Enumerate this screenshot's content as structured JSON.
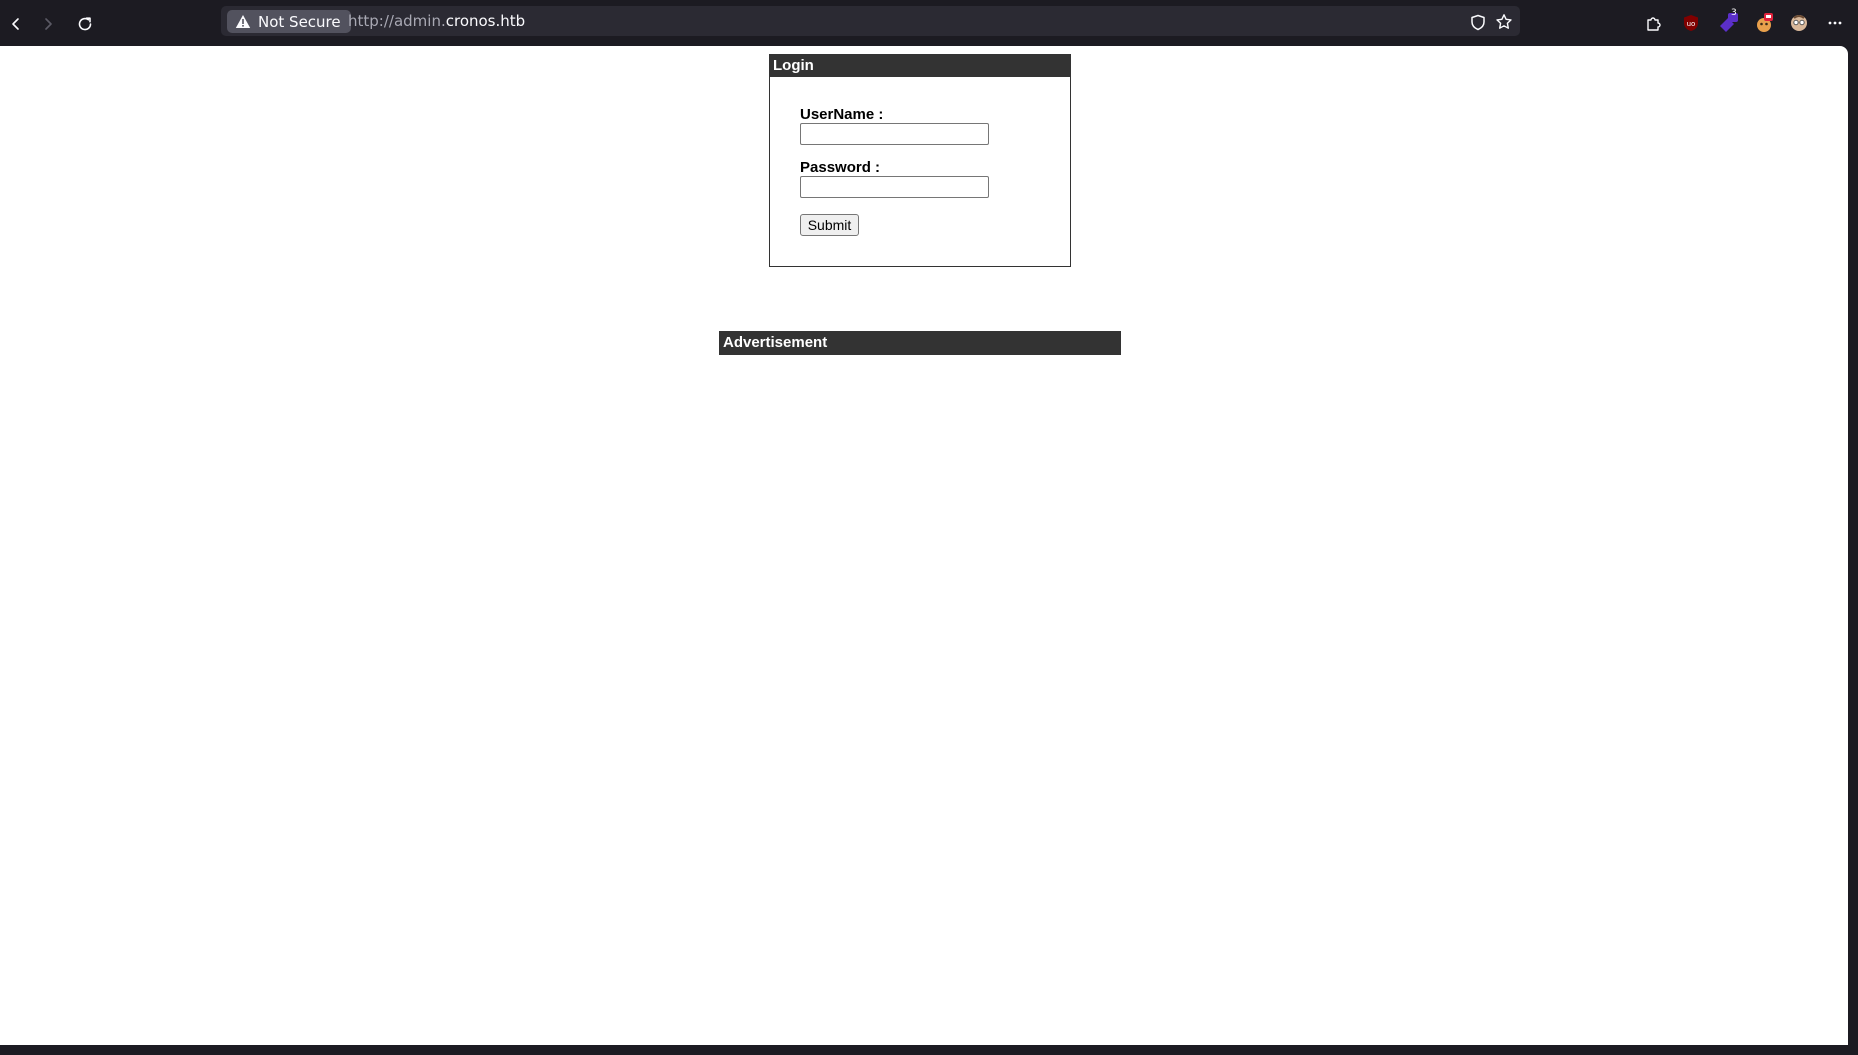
{
  "browser": {
    "security_label": "Not Secure",
    "url_prefix": "http://admin.",
    "url_domain": "cronos.htb",
    "icons": {
      "back": "back-arrow-icon",
      "forward": "forward-arrow-icon",
      "reload": "reload-icon",
      "warning": "warning-icon",
      "tracking_protection": "shield-icon",
      "bookmark": "star-icon",
      "extensions": "puzzle-icon",
      "ublock": "ublock-icon",
      "extension_badge_count": "3",
      "menu": "hamburger-dots-icon"
    }
  },
  "login": {
    "header": "Login",
    "username_label": "UserName :",
    "username_value": "",
    "password_label": "Password :",
    "password_value": "",
    "submit_label": "Submit"
  },
  "advertisement": {
    "header": "Advertisement"
  }
}
